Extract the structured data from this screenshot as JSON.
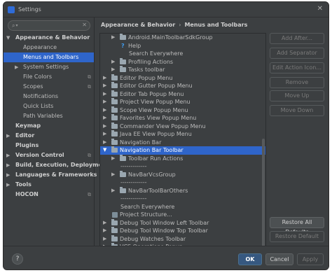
{
  "window": {
    "title": "Settings",
    "close_glyph": "✕"
  },
  "search": {
    "value": "",
    "placeholder": "",
    "clear_glyph": "✕"
  },
  "sidebar": {
    "items": [
      {
        "label": "Appearance & Behavior",
        "level": 0,
        "arrow": "▼",
        "bold": true,
        "selected": false
      },
      {
        "label": "Appearance",
        "level": 1,
        "arrow": "",
        "bold": false,
        "selected": false
      },
      {
        "label": "Menus and Toolbars",
        "level": 1,
        "arrow": "",
        "bold": false,
        "selected": true
      },
      {
        "label": "System Settings",
        "level": 1,
        "arrow": "▶",
        "bold": false,
        "selected": false
      },
      {
        "label": "File Colors",
        "level": 1,
        "arrow": "",
        "bold": false,
        "selected": false,
        "icon": "project-level-icon"
      },
      {
        "label": "Scopes",
        "level": 1,
        "arrow": "",
        "bold": false,
        "selected": false,
        "icon": "project-level-icon"
      },
      {
        "label": "Notifications",
        "level": 1,
        "arrow": "",
        "bold": false,
        "selected": false
      },
      {
        "label": "Quick Lists",
        "level": 1,
        "arrow": "",
        "bold": false,
        "selected": false
      },
      {
        "label": "Path Variables",
        "level": 1,
        "arrow": "",
        "bold": false,
        "selected": false
      },
      {
        "label": "Keymap",
        "level": 0,
        "arrow": "",
        "bold": true,
        "selected": false
      },
      {
        "label": "Editor",
        "level": 0,
        "arrow": "▶",
        "bold": true,
        "selected": false
      },
      {
        "label": "Plugins",
        "level": 0,
        "arrow": "",
        "bold": true,
        "selected": false
      },
      {
        "label": "Version Control",
        "level": 0,
        "arrow": "▶",
        "bold": true,
        "selected": false,
        "icon": "project-level-icon"
      },
      {
        "label": "Build, Execution, Deployment",
        "level": 0,
        "arrow": "▶",
        "bold": true,
        "selected": false
      },
      {
        "label": "Languages & Frameworks",
        "level": 0,
        "arrow": "▶",
        "bold": true,
        "selected": false
      },
      {
        "label": "Tools",
        "level": 0,
        "arrow": "▶",
        "bold": true,
        "selected": false
      },
      {
        "label": "HOCON",
        "level": 0,
        "arrow": "",
        "bold": true,
        "selected": false,
        "icon": "project-level-icon"
      }
    ]
  },
  "breadcrumb": {
    "parent": "Appearance & Behavior",
    "separator": "›",
    "current": "Menus and Toolbars"
  },
  "menu_tree": {
    "rows": [
      {
        "label": "Android.MainToolbarSdkGroup",
        "level": 1,
        "arrow": "▶",
        "icon": "folder-icon",
        "selected": false
      },
      {
        "label": "Help",
        "level": 2,
        "arrow": "",
        "icon": "help-icon",
        "selected": false
      },
      {
        "label": "Search Everywhere",
        "level": 2,
        "arrow": "",
        "icon": "",
        "selected": false
      },
      {
        "label": "Profiling Actions",
        "level": 1,
        "arrow": "▶",
        "icon": "folder-icon",
        "selected": false
      },
      {
        "label": "Tasks toolbar",
        "level": 1,
        "arrow": "▶",
        "icon": "folder-icon",
        "selected": false
      },
      {
        "label": "Editor Popup Menu",
        "level": 0,
        "arrow": "▶",
        "icon": "folder-icon",
        "selected": false
      },
      {
        "label": "Editor Gutter Popup Menu",
        "level": 0,
        "arrow": "▶",
        "icon": "folder-icon",
        "selected": false
      },
      {
        "label": "Editor Tab Popup Menu",
        "level": 0,
        "arrow": "▶",
        "icon": "folder-icon",
        "selected": false
      },
      {
        "label": "Project View Popup Menu",
        "level": 0,
        "arrow": "▶",
        "icon": "folder-icon",
        "selected": false
      },
      {
        "label": "Scope View Popup Menu",
        "level": 0,
        "arrow": "▶",
        "icon": "folder-icon",
        "selected": false
      },
      {
        "label": "Favorites View Popup Menu",
        "level": 0,
        "arrow": "▶",
        "icon": "folder-icon",
        "selected": false
      },
      {
        "label": "Commander View Popup Menu",
        "level": 0,
        "arrow": "▶",
        "icon": "folder-icon",
        "selected": false
      },
      {
        "label": "Java EE View Popup Menu",
        "level": 0,
        "arrow": "▶",
        "icon": "folder-icon",
        "selected": false
      },
      {
        "label": "Navigation Bar",
        "level": 0,
        "arrow": "▶",
        "icon": "folder-icon",
        "selected": false
      },
      {
        "label": "Navigation Bar Toolbar",
        "level": 0,
        "arrow": "▼",
        "icon": "folder-icon",
        "selected": true
      },
      {
        "label": "Toolbar Run Actions",
        "level": 1,
        "arrow": "▶",
        "icon": "folder-icon",
        "selected": false
      },
      {
        "label": "-------------",
        "level": 1,
        "arrow": "",
        "icon": "",
        "selected": false
      },
      {
        "label": "NavBarVcsGroup",
        "level": 1,
        "arrow": "▶",
        "icon": "folder-icon",
        "selected": false
      },
      {
        "label": "-------------",
        "level": 1,
        "arrow": "",
        "icon": "",
        "selected": false
      },
      {
        "label": "NavBarToolBarOthers",
        "level": 1,
        "arrow": "▶",
        "icon": "folder-icon",
        "selected": false
      },
      {
        "label": "-------------",
        "level": 1,
        "arrow": "",
        "icon": "",
        "selected": false
      },
      {
        "label": "Search Everywhere",
        "level": 1,
        "arrow": "",
        "icon": "",
        "selected": false
      },
      {
        "label": "Project Structure...",
        "level": 1,
        "arrow": "",
        "icon": "action-icon",
        "selected": false
      },
      {
        "label": "Debug Tool Window Left Toolbar",
        "level": 0,
        "arrow": "▶",
        "icon": "folder-icon",
        "selected": false
      },
      {
        "label": "Debug Tool Window Top Toolbar",
        "level": 0,
        "arrow": "▶",
        "icon": "folder-icon",
        "selected": false
      },
      {
        "label": "Debug Watches Toolbar",
        "level": 0,
        "arrow": "▶",
        "icon": "folder-icon",
        "selected": false
      },
      {
        "label": "VCS Operations Popup",
        "level": 0,
        "arrow": "▶",
        "icon": "folder-icon",
        "selected": false
      }
    ]
  },
  "side_buttons": {
    "add_after": "Add After...",
    "add_separator": "Add Separator",
    "edit_action_icon": "Edit Action Icon...",
    "remove": "Remove",
    "move_up": "Move Up",
    "move_down": "Move Down",
    "restore_all_defaults": "Restore All Defaults",
    "restore_default": "Restore Default"
  },
  "footer": {
    "help": "?",
    "ok": "OK",
    "cancel": "Cancel",
    "apply": "Apply"
  },
  "colors": {
    "background": "#3c3f41",
    "selection": "#2f65ca",
    "ok_button": "#365880",
    "text": "#bbbbbb"
  }
}
